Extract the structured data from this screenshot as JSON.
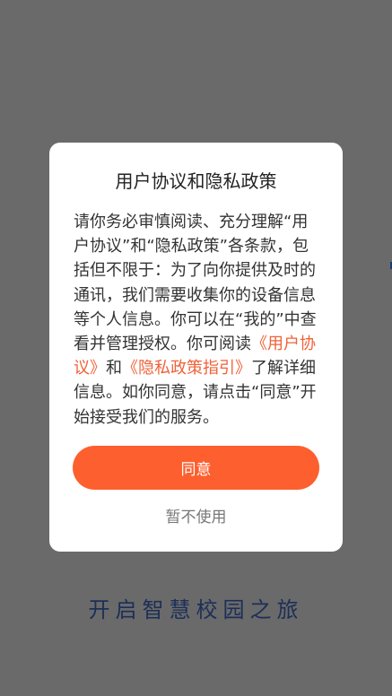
{
  "background": {
    "slogan": "开启智慧校园之旅",
    "overlay_color": "#6a6a6a",
    "slogan_color": "#1c2f57"
  },
  "dialog": {
    "title": "用户协议和隐私政策",
    "body": {
      "part1": "请你务必审慎阅读、充分理解“用户协议”和“隐私政策”各条款，包括但不限于：为了向你提供及时的通讯，我们需要收集你的设备信息等个人信息。你可以在“我的”中查看并管理授权。你可阅读",
      "link_user_agreement": "《用户协议》",
      "connector": "和",
      "link_privacy_guide": "《隐私政策指引》",
      "part2": "了解详细信息。如你同意，请点击“同意”开始接受我们的服务。"
    },
    "agree_button": "同意",
    "decline_button": "暂不使用",
    "accent_color": "#fd5f2e",
    "link_color": "#f0623a"
  }
}
